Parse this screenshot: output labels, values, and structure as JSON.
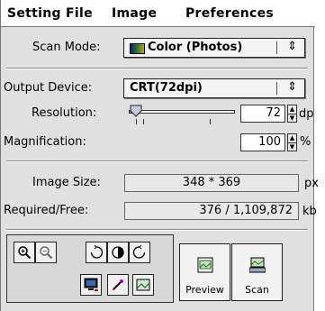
{
  "menu": {
    "items": [
      "Setting File",
      "Image",
      "Preferences"
    ]
  },
  "scan_mode": {
    "label": "Scan Mode:",
    "value": "Color (Photos)",
    "arrows": "⇕",
    "icon": "color-swatch-icon"
  },
  "output_device": {
    "label": "Output Device:",
    "value": "CRT(72dpi)",
    "arrows": "⇕"
  },
  "resolution": {
    "label": "Resolution:",
    "value": "72",
    "unit": "dp",
    "slider_level": 0.07
  },
  "magnification": {
    "label": "Magnification:",
    "value": "100",
    "unit": "%"
  },
  "image_size": {
    "label": "Image Size:",
    "value": "348 * 369",
    "unit": "px"
  },
  "required_free": {
    "label": "Required/Free:",
    "value": "376 / 1,109,872",
    "unit": "kb"
  },
  "tools": {
    "zoom_in": "zoom-in-icon",
    "zoom_out": "zoom-out-icon",
    "rotate_left": "rotate-left-icon",
    "flip": "flip-icon",
    "rotate_right": "rotate-right-icon",
    "monitor": "monitor-icon",
    "eyedropper": "eyedropper-icon",
    "image": "image-icon"
  },
  "actions": {
    "preview_label": "Preview",
    "scan_label": "Scan"
  }
}
